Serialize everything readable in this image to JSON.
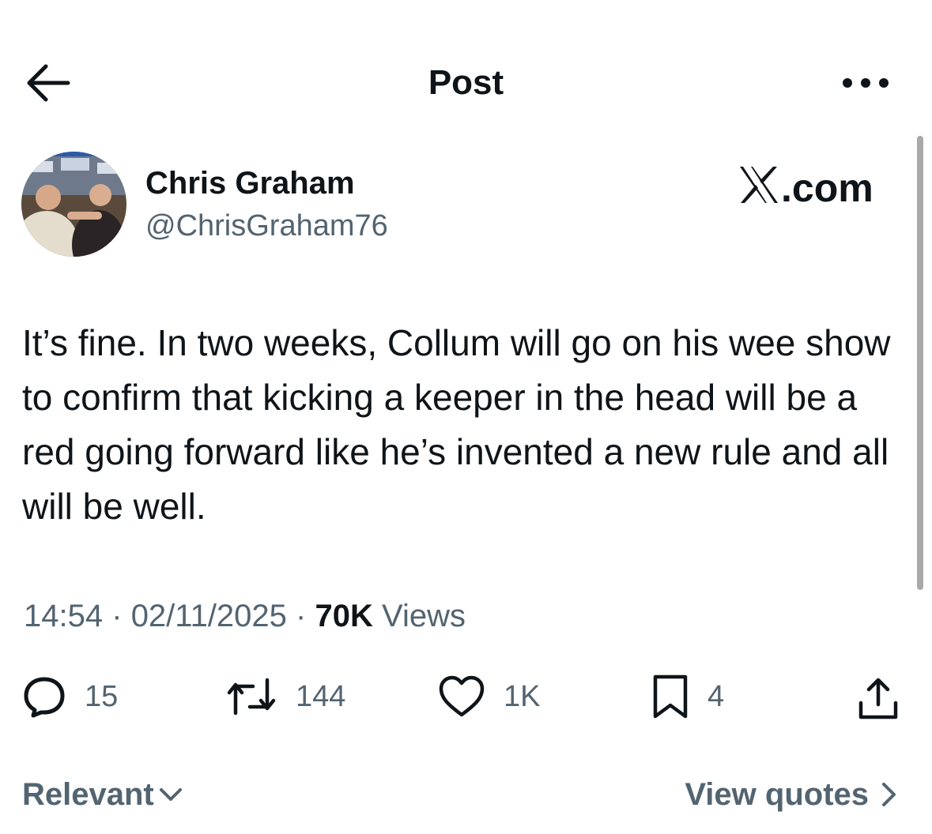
{
  "header": {
    "title": "Post",
    "back_icon": "arrow-left-icon",
    "more_icon": "more-horizontal-icon"
  },
  "author": {
    "name": "Chris Graham",
    "handle": "@ChrisGraham76",
    "brand": "X.com"
  },
  "post": {
    "text": "It’s fine. In two weeks, Collum will go on his wee show to confirm that kicking a keeper in the head will be a red going forward like he’s invented a new rule and all will be well.",
    "time": "14:54",
    "date": "02/11/2025",
    "views_count": "70K",
    "views_label": "Views",
    "separator": "·"
  },
  "actions": {
    "replies": "15",
    "reposts": "144",
    "likes": "1K",
    "bookmarks": "4"
  },
  "footer": {
    "sort_label": "Relevant",
    "view_quotes_label": "View quotes"
  },
  "colors": {
    "text": "#0f1419",
    "secondary": "#536471",
    "background": "#ffffff"
  }
}
